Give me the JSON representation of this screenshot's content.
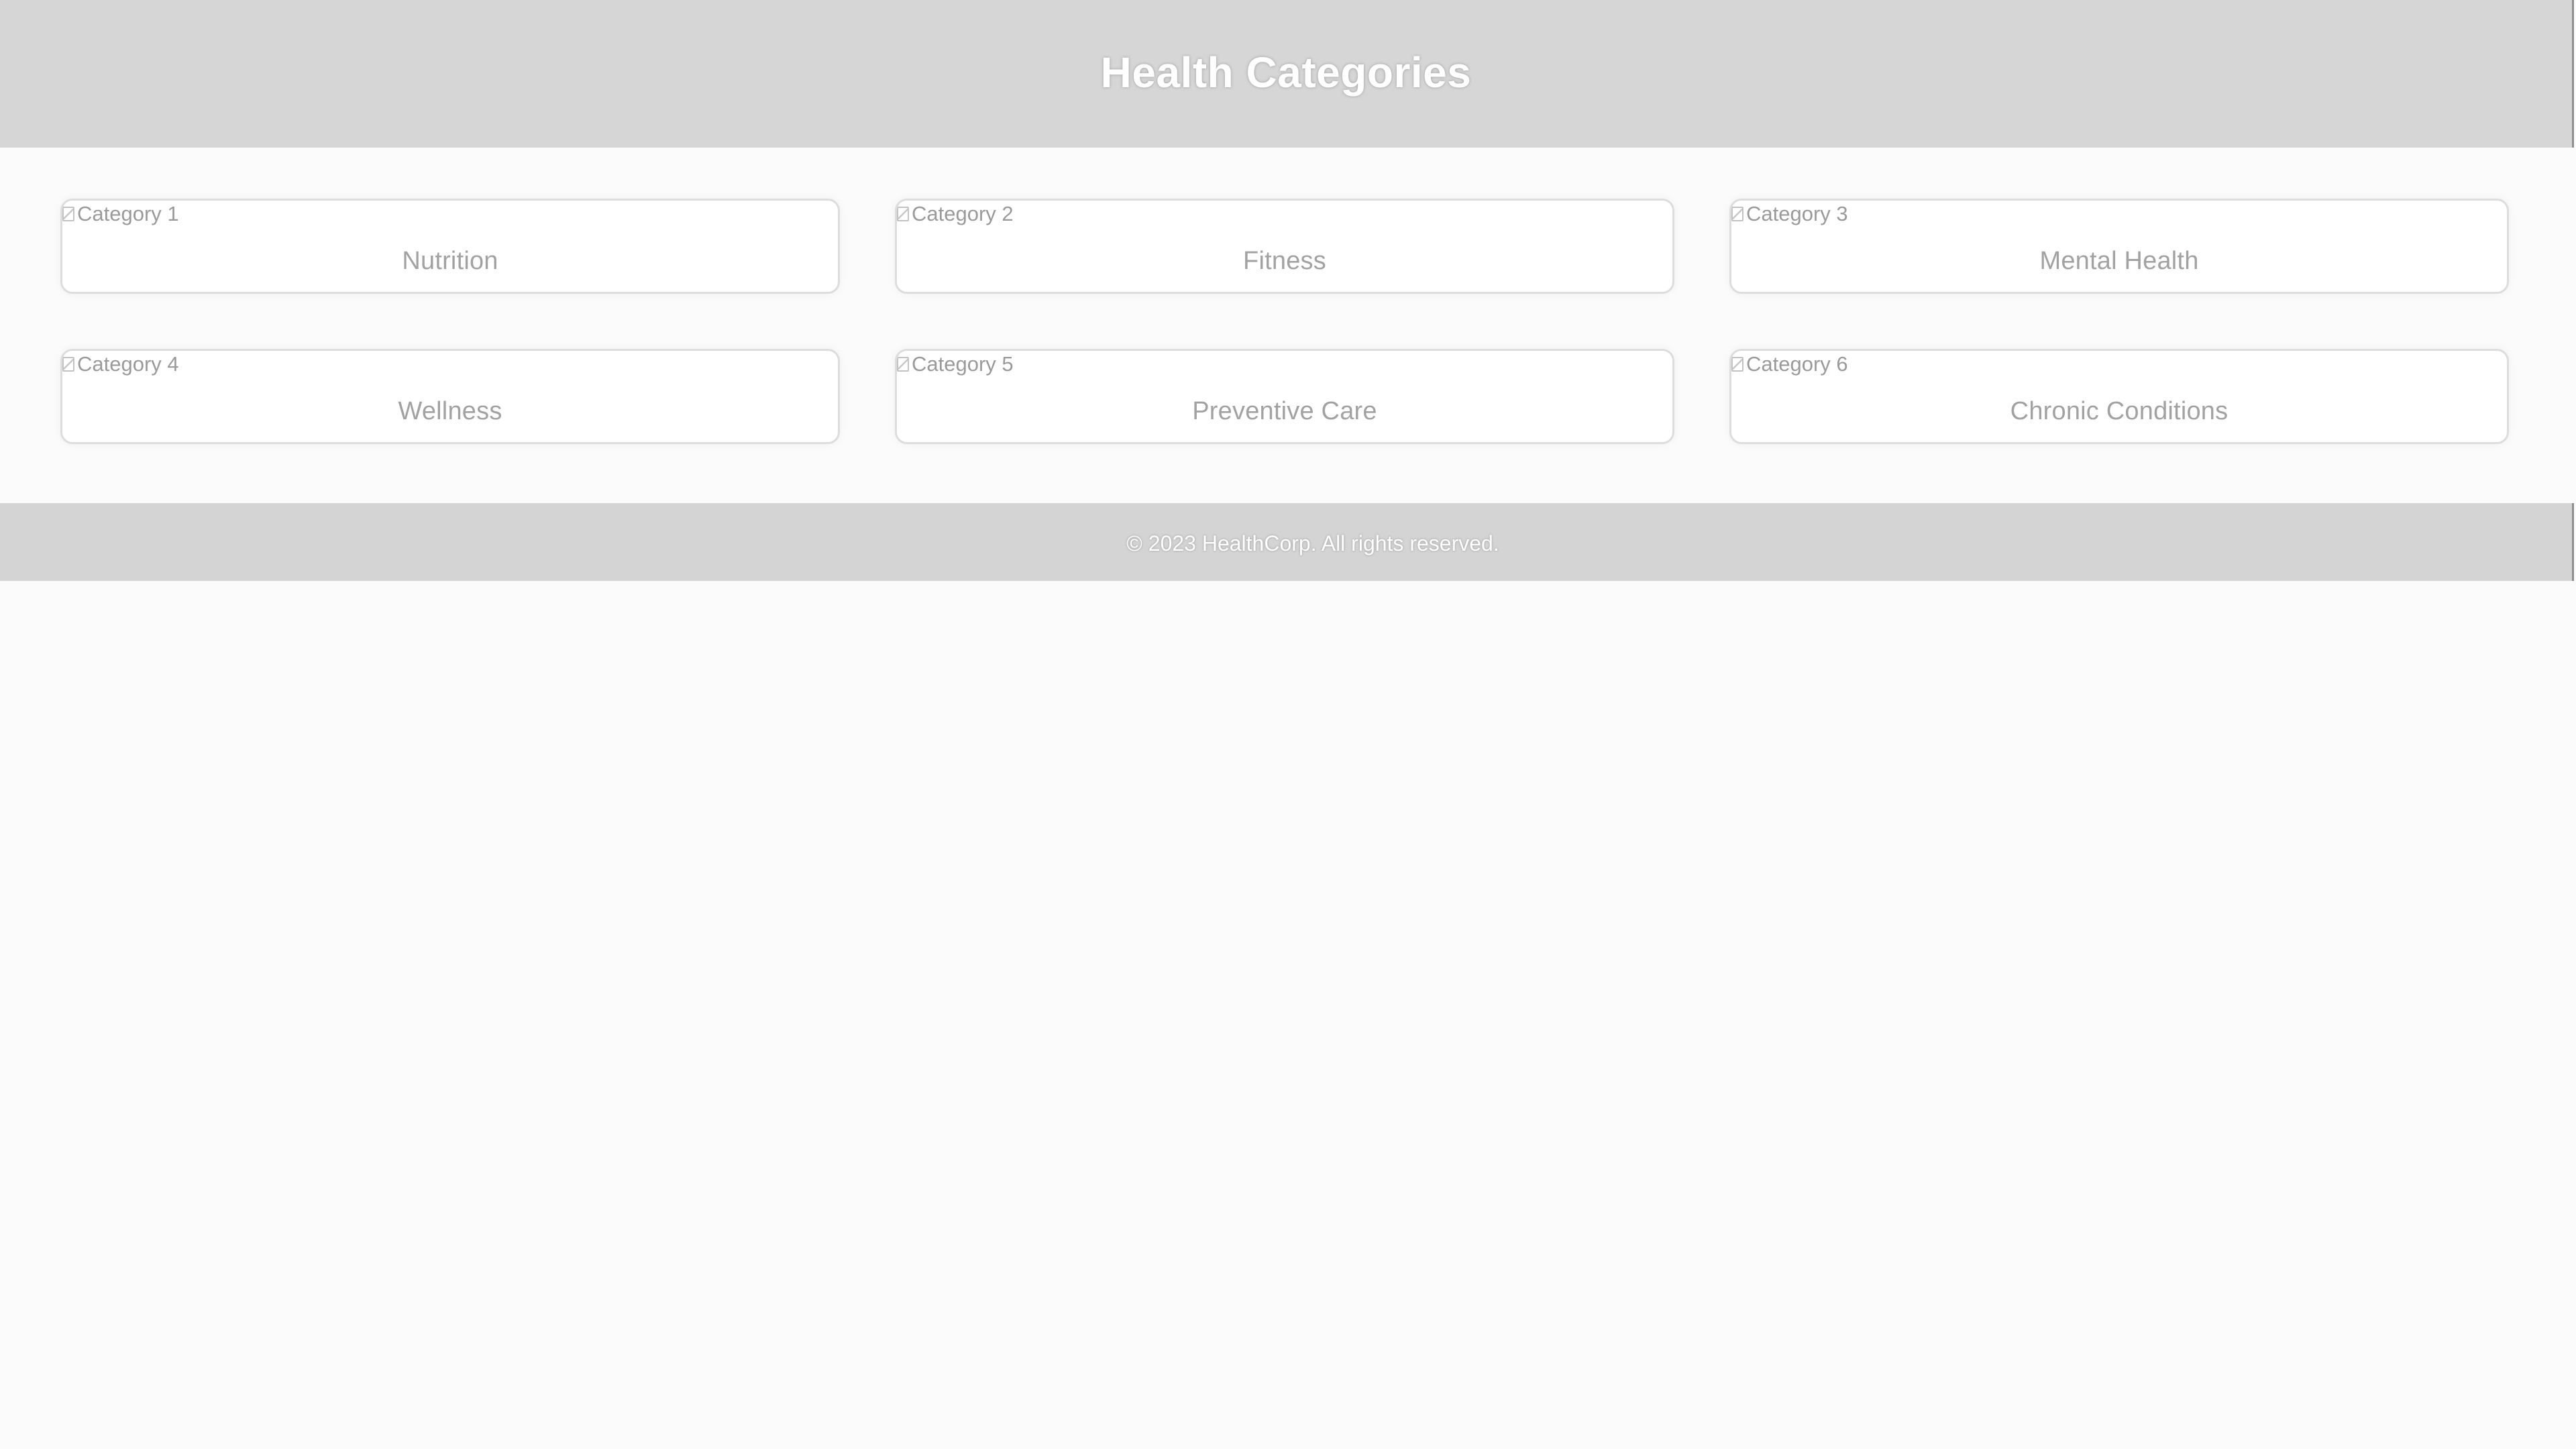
{
  "header": {
    "title": "Health Categories"
  },
  "categories": [
    {
      "image_alt": "Category 1",
      "label": "Nutrition"
    },
    {
      "image_alt": "Category 2",
      "label": "Fitness"
    },
    {
      "image_alt": "Category 3",
      "label": "Mental Health"
    },
    {
      "image_alt": "Category 4",
      "label": "Wellness"
    },
    {
      "image_alt": "Category 5",
      "label": "Preventive Care"
    },
    {
      "image_alt": "Category 6",
      "label": "Chronic Conditions"
    }
  ],
  "footer": {
    "copyright": "© 2023 HealthCorp. All rights reserved."
  },
  "colors": {
    "header_background": "#d6d6d6",
    "page_background": "#fbfbfb",
    "card_border": "#dddddd",
    "card_text": "#a2a2a2",
    "footer_background": "#d4d4d4"
  },
  "icons": {
    "broken_image": "broken-image-icon"
  }
}
